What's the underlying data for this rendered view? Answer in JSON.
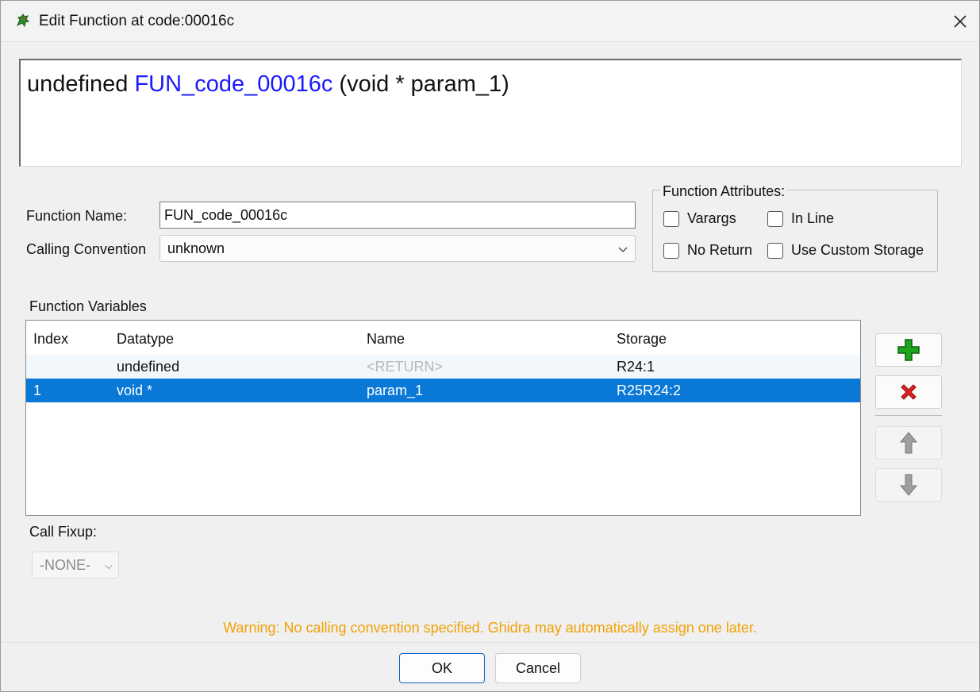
{
  "window": {
    "title": "Edit Function at code:00016c"
  },
  "signature": {
    "return_type": "undefined",
    "function_name": "FUN_code_00016c",
    "params": "(void * param_1)"
  },
  "form": {
    "function_name_label": "Function Name:",
    "function_name_value": "FUN_code_00016c",
    "calling_convention_label": "Calling Convention",
    "calling_convention_value": "unknown"
  },
  "attributes": {
    "title": "Function Attributes:",
    "varargs": {
      "label": "Varargs",
      "checked": false
    },
    "inline": {
      "label": "In Line",
      "checked": false
    },
    "no_return": {
      "label": "No Return",
      "checked": false
    },
    "custom_storage": {
      "label": "Use Custom Storage",
      "checked": false
    }
  },
  "variables": {
    "label": "Function Variables",
    "columns": [
      "Index",
      "Datatype",
      "Name",
      "Storage"
    ],
    "rows": [
      {
        "index": "",
        "datatype": "undefined",
        "name": "<RETURN>",
        "storage": "R24:1"
      },
      {
        "index": "1",
        "datatype": "void *",
        "name": "param_1",
        "storage": "R25R24:2"
      }
    ],
    "selected_row": 1
  },
  "side_buttons": {
    "add": "plus-icon",
    "remove": "delete-x-icon",
    "up": "arrow-up-icon",
    "down": "arrow-down-icon"
  },
  "call_fixup": {
    "label": "Call Fixup:",
    "value": "-NONE-"
  },
  "warning": "Warning: No calling convention specified. Ghidra may automatically assign one later.",
  "buttons": {
    "ok": "OK",
    "cancel": "Cancel"
  },
  "colors": {
    "function_name": "#1a1aff",
    "selection": "#0a78d7",
    "warning": "#f2a104",
    "add_icon": "#1ea51e",
    "delete_icon": "#e02020"
  }
}
